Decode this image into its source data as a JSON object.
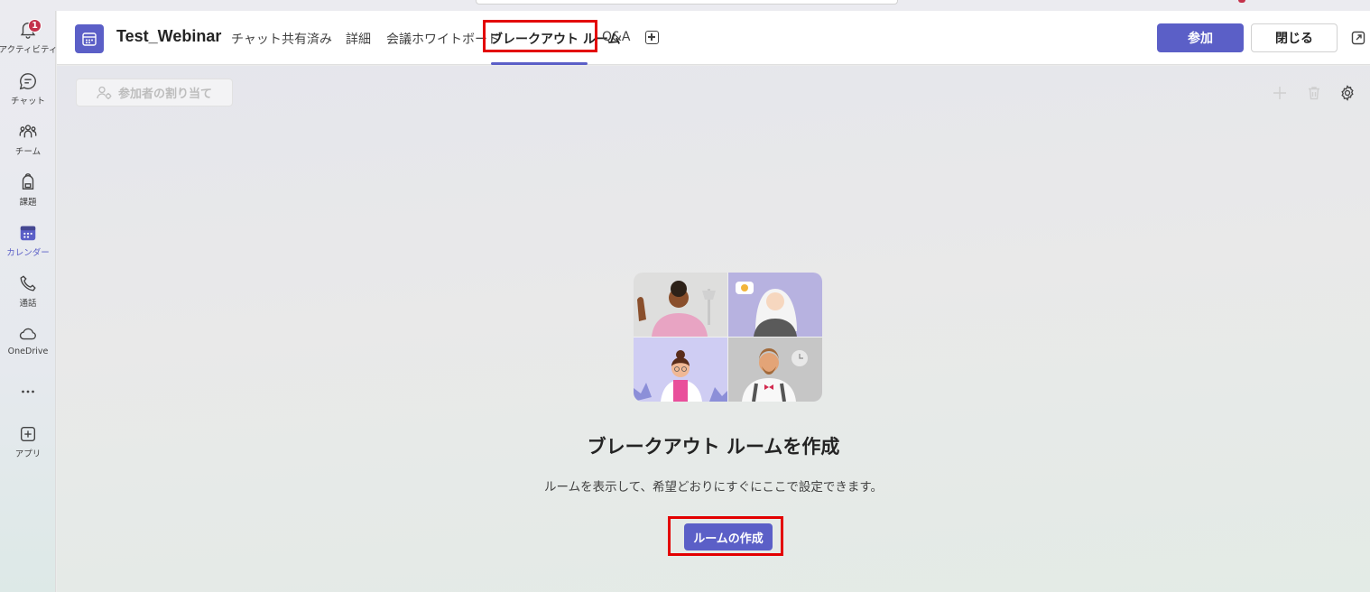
{
  "rail": {
    "items": [
      {
        "label": "アクティビティ",
        "icon": "bell-icon",
        "badge": "1"
      },
      {
        "label": "チャット",
        "icon": "chat-icon"
      },
      {
        "label": "チーム",
        "icon": "teams-icon"
      },
      {
        "label": "課題",
        "icon": "backpack-icon"
      },
      {
        "label": "カレンダー",
        "icon": "calendar-icon",
        "active": true
      },
      {
        "label": "通話",
        "icon": "phone-icon"
      },
      {
        "label": "OneDrive",
        "icon": "cloud-icon"
      },
      {
        "label": "",
        "icon": "more-icon"
      },
      {
        "label": "アプリ",
        "icon": "add-apps-icon"
      }
    ]
  },
  "header": {
    "title": "Test_Webinar",
    "tabs": [
      "チャット",
      "共有済み",
      "詳細",
      "会議ホワイトボード",
      "ブレークアウト ルーム",
      "Q&A"
    ],
    "active_tab": "ブレークアウト ルーム",
    "join_label": "参加",
    "close_label": "閉じる"
  },
  "toolbar": {
    "assign_label": "参加者の割り当て"
  },
  "empty_state": {
    "title": "ブレークアウト ルームを作成",
    "subtitle": "ルームを表示して、希望どおりにすぐにここで設定できます。",
    "create_label": "ルームの作成"
  },
  "colors": {
    "brand": "#5b5fc7",
    "badge": "#c4314b",
    "highlight": "#e30000"
  }
}
